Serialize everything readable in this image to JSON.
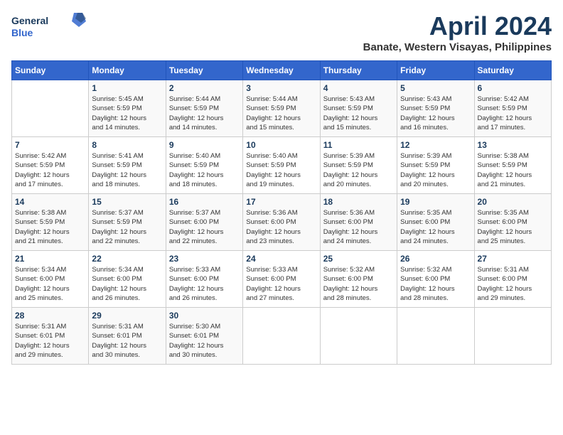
{
  "logo": {
    "line1": "General",
    "line2": "Blue"
  },
  "title": "April 2024",
  "subtitle": "Banate, Western Visayas, Philippines",
  "days_of_week": [
    "Sunday",
    "Monday",
    "Tuesday",
    "Wednesday",
    "Thursday",
    "Friday",
    "Saturday"
  ],
  "weeks": [
    [
      {
        "day": "",
        "info": ""
      },
      {
        "day": "1",
        "info": "Sunrise: 5:45 AM\nSunset: 5:59 PM\nDaylight: 12 hours\nand 14 minutes."
      },
      {
        "day": "2",
        "info": "Sunrise: 5:44 AM\nSunset: 5:59 PM\nDaylight: 12 hours\nand 14 minutes."
      },
      {
        "day": "3",
        "info": "Sunrise: 5:44 AM\nSunset: 5:59 PM\nDaylight: 12 hours\nand 15 minutes."
      },
      {
        "day": "4",
        "info": "Sunrise: 5:43 AM\nSunset: 5:59 PM\nDaylight: 12 hours\nand 15 minutes."
      },
      {
        "day": "5",
        "info": "Sunrise: 5:43 AM\nSunset: 5:59 PM\nDaylight: 12 hours\nand 16 minutes."
      },
      {
        "day": "6",
        "info": "Sunrise: 5:42 AM\nSunset: 5:59 PM\nDaylight: 12 hours\nand 17 minutes."
      }
    ],
    [
      {
        "day": "7",
        "info": "Sunrise: 5:42 AM\nSunset: 5:59 PM\nDaylight: 12 hours\nand 17 minutes."
      },
      {
        "day": "8",
        "info": "Sunrise: 5:41 AM\nSunset: 5:59 PM\nDaylight: 12 hours\nand 18 minutes."
      },
      {
        "day": "9",
        "info": "Sunrise: 5:40 AM\nSunset: 5:59 PM\nDaylight: 12 hours\nand 18 minutes."
      },
      {
        "day": "10",
        "info": "Sunrise: 5:40 AM\nSunset: 5:59 PM\nDaylight: 12 hours\nand 19 minutes."
      },
      {
        "day": "11",
        "info": "Sunrise: 5:39 AM\nSunset: 5:59 PM\nDaylight: 12 hours\nand 20 minutes."
      },
      {
        "day": "12",
        "info": "Sunrise: 5:39 AM\nSunset: 5:59 PM\nDaylight: 12 hours\nand 20 minutes."
      },
      {
        "day": "13",
        "info": "Sunrise: 5:38 AM\nSunset: 5:59 PM\nDaylight: 12 hours\nand 21 minutes."
      }
    ],
    [
      {
        "day": "14",
        "info": "Sunrise: 5:38 AM\nSunset: 5:59 PM\nDaylight: 12 hours\nand 21 minutes."
      },
      {
        "day": "15",
        "info": "Sunrise: 5:37 AM\nSunset: 5:59 PM\nDaylight: 12 hours\nand 22 minutes."
      },
      {
        "day": "16",
        "info": "Sunrise: 5:37 AM\nSunset: 6:00 PM\nDaylight: 12 hours\nand 22 minutes."
      },
      {
        "day": "17",
        "info": "Sunrise: 5:36 AM\nSunset: 6:00 PM\nDaylight: 12 hours\nand 23 minutes."
      },
      {
        "day": "18",
        "info": "Sunrise: 5:36 AM\nSunset: 6:00 PM\nDaylight: 12 hours\nand 24 minutes."
      },
      {
        "day": "19",
        "info": "Sunrise: 5:35 AM\nSunset: 6:00 PM\nDaylight: 12 hours\nand 24 minutes."
      },
      {
        "day": "20",
        "info": "Sunrise: 5:35 AM\nSunset: 6:00 PM\nDaylight: 12 hours\nand 25 minutes."
      }
    ],
    [
      {
        "day": "21",
        "info": "Sunrise: 5:34 AM\nSunset: 6:00 PM\nDaylight: 12 hours\nand 25 minutes."
      },
      {
        "day": "22",
        "info": "Sunrise: 5:34 AM\nSunset: 6:00 PM\nDaylight: 12 hours\nand 26 minutes."
      },
      {
        "day": "23",
        "info": "Sunrise: 5:33 AM\nSunset: 6:00 PM\nDaylight: 12 hours\nand 26 minutes."
      },
      {
        "day": "24",
        "info": "Sunrise: 5:33 AM\nSunset: 6:00 PM\nDaylight: 12 hours\nand 27 minutes."
      },
      {
        "day": "25",
        "info": "Sunrise: 5:32 AM\nSunset: 6:00 PM\nDaylight: 12 hours\nand 28 minutes."
      },
      {
        "day": "26",
        "info": "Sunrise: 5:32 AM\nSunset: 6:00 PM\nDaylight: 12 hours\nand 28 minutes."
      },
      {
        "day": "27",
        "info": "Sunrise: 5:31 AM\nSunset: 6:00 PM\nDaylight: 12 hours\nand 29 minutes."
      }
    ],
    [
      {
        "day": "28",
        "info": "Sunrise: 5:31 AM\nSunset: 6:01 PM\nDaylight: 12 hours\nand 29 minutes."
      },
      {
        "day": "29",
        "info": "Sunrise: 5:31 AM\nSunset: 6:01 PM\nDaylight: 12 hours\nand 30 minutes."
      },
      {
        "day": "30",
        "info": "Sunrise: 5:30 AM\nSunset: 6:01 PM\nDaylight: 12 hours\nand 30 minutes."
      },
      {
        "day": "",
        "info": ""
      },
      {
        "day": "",
        "info": ""
      },
      {
        "day": "",
        "info": ""
      },
      {
        "day": "",
        "info": ""
      }
    ]
  ]
}
